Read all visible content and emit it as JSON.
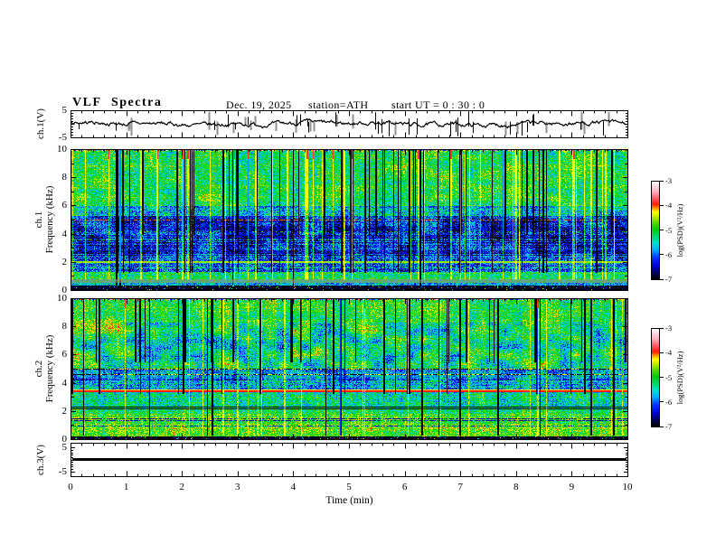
{
  "title": "VLF Spectra",
  "header": {
    "date": "Dec. 19, 2025",
    "station": "station=ATH",
    "start_ut": "start UT =  0 : 30 : 0"
  },
  "x_axis": {
    "label": "Time  (min)",
    "min": 0,
    "max": 10,
    "major_ticks": [
      0,
      1,
      2,
      3,
      4,
      5,
      6,
      7,
      8,
      9,
      10
    ],
    "minor_step": 0.2
  },
  "colorbar": {
    "label": "log(PSD)(V²/Hz)",
    "ticks": [
      -3,
      -4,
      -5,
      -6,
      -7
    ],
    "min": -7,
    "max": -3,
    "stops": [
      {
        "v": -7.0,
        "c": "#000000"
      },
      {
        "v": -6.8,
        "c": "#00003a"
      },
      {
        "v": -6.45,
        "c": "#0000cf"
      },
      {
        "v": -6.1,
        "c": "#0033ff"
      },
      {
        "v": -5.8,
        "c": "#00aaff"
      },
      {
        "v": -5.5,
        "c": "#00e0cc"
      },
      {
        "v": -5.15,
        "c": "#00d24a"
      },
      {
        "v": -4.95,
        "c": "#06c906"
      },
      {
        "v": -4.65,
        "c": "#67dc00"
      },
      {
        "v": -4.4,
        "c": "#d6ef00"
      },
      {
        "v": -4.25,
        "c": "#ffff00"
      },
      {
        "v": -4.1,
        "c": "#ff9500"
      },
      {
        "v": -3.95,
        "c": "#ff1e00"
      },
      {
        "v": -3.75,
        "c": "#ff4e5a"
      },
      {
        "v": -3.45,
        "c": "#ffaab8"
      },
      {
        "v": -3.15,
        "c": "#ffe4ea"
      },
      {
        "v": -3.0,
        "c": "#ffffff"
      }
    ]
  },
  "chart_data": [
    {
      "id": "ch1_waveform",
      "type": "line",
      "ylabel": "ch.1(V)",
      "ylim": [
        -5,
        5
      ],
      "yticks": [
        5,
        -5
      ],
      "signal": {
        "baseline": 0,
        "noise_amp": 0.5,
        "drift_amp": 0.35,
        "spike_count": 52,
        "spike_min": 1.8,
        "spike_max": 4.8,
        "gray_fraction": 0.45,
        "seed": 7
      }
    },
    {
      "id": "ch1_spectrogram",
      "type": "heatmap",
      "ylabel_lines": [
        "ch.1",
        "Frequency  (kHz)"
      ],
      "ylim": [
        0,
        10
      ],
      "yticks": [
        10,
        8,
        6,
        4,
        2,
        0
      ],
      "psd_range": [
        -7,
        -3
      ],
      "seed": 101,
      "bands": [
        {
          "lo": 9.93,
          "hi": 10,
          "base": -5,
          "fine": 2.2,
          "coarse": 0,
          "row": 0
        },
        {
          "lo": 6,
          "hi": 9.93,
          "base": -5.05,
          "fine": 0.5,
          "coarse": 0.35,
          "row": 0.15
        },
        {
          "lo": 5.3,
          "hi": 6,
          "base": -5.55,
          "fine": 0.55,
          "coarse": 0.4,
          "row": 0.2
        },
        {
          "lo": 2.5,
          "hi": 5.3,
          "base": -6.25,
          "fine": 0.55,
          "coarse": 0.45,
          "row": 0.3
        },
        {
          "lo": 1.3,
          "hi": 2.5,
          "base": -6.0,
          "fine": 0.6,
          "coarse": 0.3,
          "row": 0.25
        },
        {
          "lo": 0.78,
          "hi": 1.3,
          "base": -5.15,
          "fine": 0.5,
          "coarse": 0.2,
          "row": 0.15
        },
        {
          "lo": 0.55,
          "hi": 0.78,
          "base": -5.2,
          "fine": 0.35,
          "coarse": 0,
          "gray": true
        },
        {
          "lo": 0.35,
          "hi": 0.55,
          "base": -5.75,
          "fine": 0.5,
          "coarse": 0.2
        },
        {
          "lo": 0,
          "hi": 0.35,
          "base": -6.92,
          "fine": 0.15,
          "coarse": 0,
          "speck": 0.05
        }
      ],
      "hlines": [
        {
          "f": 5.0,
          "level": -4.05,
          "dot": 0.45
        },
        {
          "f": 4.15,
          "level": -4.85,
          "dot": 0.25
        },
        {
          "f": 3.6,
          "level": -4.9,
          "dot": 0.3
        },
        {
          "f": 2.0,
          "level": -4.55,
          "w": 2
        },
        {
          "f": 1.62,
          "level": -5.0,
          "dot": 0.35
        }
      ],
      "vstripes": {
        "dark": {
          "count": 58,
          "lo": 1.3,
          "hi": 10,
          "short_frac": 0.3,
          "short_lo": 4,
          "full_frac": 0.15,
          "full_lo": 0.4
        },
        "bright": {
          "count": 50,
          "lo": 0.8,
          "hi": 10,
          "delta": 1.15,
          "cap": -4.25,
          "red_top_frac": 0.35
        }
      }
    },
    {
      "id": "ch2_spectrogram",
      "type": "heatmap",
      "ylabel_lines": [
        "ch.2",
        "Frequency  (kHz)"
      ],
      "ylim": [
        0,
        10
      ],
      "yticks": [
        10,
        8,
        6,
        4,
        2,
        0
      ],
      "psd_range": [
        -7,
        -3
      ],
      "seed": 202,
      "bands": [
        {
          "lo": 9.93,
          "hi": 10,
          "base": -5,
          "fine": 2.2,
          "coarse": 0,
          "row": 0
        },
        {
          "lo": 8.3,
          "hi": 9.93,
          "base": -5.0,
          "fine": 0.5,
          "coarse": 0.3,
          "row": 0.15
        },
        {
          "lo": 5.0,
          "hi": 8.3,
          "base": -5.25,
          "fine": 0.55,
          "coarse": 0.65,
          "row": 0.2
        },
        {
          "lo": 4.2,
          "hi": 5.0,
          "base": -5.95,
          "fine": 0.5,
          "coarse": 0.4,
          "row": 0.25
        },
        {
          "lo": 3.5,
          "hi": 4.2,
          "base": -5.6,
          "fine": 0.6,
          "coarse": 0.3,
          "row": 0.25
        },
        {
          "lo": 2.4,
          "hi": 3.5,
          "base": -5.3,
          "fine": 0.55,
          "coarse": 0.25,
          "row": 0.2
        },
        {
          "lo": 1.8,
          "hi": 2.4,
          "base": -5.1,
          "fine": 0.5,
          "coarse": 0.2,
          "row": 0.2
        },
        {
          "lo": 0.9,
          "hi": 1.8,
          "base": -4.9,
          "fine": 0.45,
          "coarse": 0.15,
          "row": 0.25
        },
        {
          "lo": 0.25,
          "hi": 0.9,
          "base": -4.75,
          "fine": 0.5,
          "coarse": 0.15,
          "row": 0.2
        },
        {
          "lo": 0,
          "hi": 0.25,
          "base": -6.92,
          "fine": 0.15,
          "coarse": 0,
          "speck": 0.06
        }
      ],
      "hlines": [
        {
          "f": 5.0,
          "level": -4.15,
          "dot": 0.45,
          "darkdot": true
        },
        {
          "f": 4.62,
          "level": -4.25,
          "dot": 0.4,
          "darkdot": true
        },
        {
          "f": 3.5,
          "level": -4.2
        },
        {
          "f": 3.4,
          "level": -3.95,
          "w": 2
        },
        {
          "f": 2.3,
          "level": -6.95
        },
        {
          "f": 2.15,
          "level": -6.95
        },
        {
          "f": 1.5,
          "level": -6.6,
          "dot": 0.7
        },
        {
          "f": 1.35,
          "level": -6.55,
          "dot": 0.7
        },
        {
          "f": 0.95,
          "level": -6.3,
          "dot": 0.5
        },
        {
          "f": 0.3,
          "level": -4.7,
          "dot": 0.6
        }
      ],
      "vstripes": {
        "dark": {
          "count": 52,
          "lo": 3.3,
          "hi": 10,
          "short_frac": 0.35,
          "short_lo": 5.5,
          "full_frac": 0.3,
          "full_lo": 0.3
        },
        "bright": {
          "count": 22,
          "lo": 0.3,
          "hi": 10,
          "delta": 0.9,
          "cap": -4.3,
          "red_top_frac": 0.2
        }
      }
    },
    {
      "id": "ch3_waveform",
      "type": "line",
      "ylabel": "ch.3(V)",
      "ylim": [
        -7,
        7
      ],
      "yticks": [
        5,
        -5
      ],
      "signal": {
        "constant": 0,
        "line_width": 3
      }
    }
  ]
}
